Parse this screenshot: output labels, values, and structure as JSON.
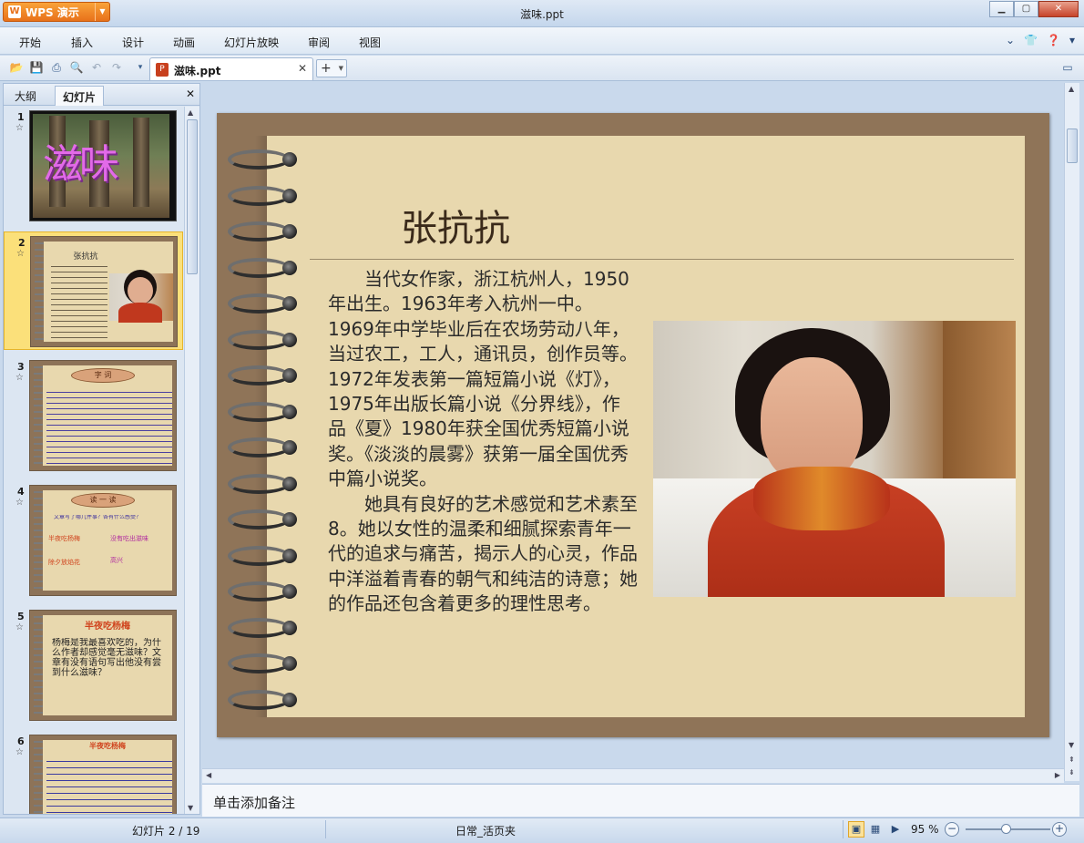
{
  "app": {
    "button_label": "WPS 演示",
    "window_title": "滋味.ppt"
  },
  "menu": [
    "开始",
    "插入",
    "设计",
    "动画",
    "幻灯片放映",
    "审阅",
    "视图"
  ],
  "document_tab": {
    "name": "滋味.ppt"
  },
  "left_panel": {
    "tabs": [
      "大纲",
      "幻灯片"
    ],
    "active_tab": "幻灯片",
    "slides": [
      {
        "number": "1",
        "title": "滋味"
      },
      {
        "number": "2",
        "title": "张抗抗"
      },
      {
        "number": "3",
        "title": "字 词"
      },
      {
        "number": "4",
        "title": "读 一 读",
        "question": "文章写了哪几件事？各有什么感受？",
        "items": [
          "半夜吃杨梅",
          "没有吃出滋味",
          "除夕放焰花",
          "高兴"
        ]
      },
      {
        "number": "5",
        "title": "半夜吃杨梅",
        "body": "杨梅是我最喜欢吃的，为什么作者却感觉毫无滋味？文章有没有语句写出他没有尝到什么滋味？"
      },
      {
        "number": "6",
        "title": "半夜吃杨梅"
      }
    ],
    "selected_slide": "2"
  },
  "slide": {
    "title": "张抗抗",
    "paragraphs": [
      "当代女作家，浙江杭州人，1950年出生。1963年考入杭州一中。1969年中学毕业后在农场劳动八年，当过农工，工人，通讯员，创作员等。1972年发表第一篇短篇小说《灯》，1975年出版长篇小说《分界线》，作品《夏》1980年获全国优秀短篇小说奖。《淡淡的晨雾》获第一届全国优秀中篇小说奖。",
      "她具有良好的艺术感觉和艺术素至8。她以女性的温柔和细腻探索青年一代的追求与痛苦，揭示人的心灵，作品中洋溢着青春的朝气和纯洁的诗意；她的作品还包含着更多的理性思考。"
    ]
  },
  "notes": {
    "placeholder": "单击添加备注"
  },
  "status": {
    "slide_indicator": "幻灯片 2 / 19",
    "template": "日常_活页夹",
    "zoom": "95 %",
    "zoom_value": 95
  }
}
